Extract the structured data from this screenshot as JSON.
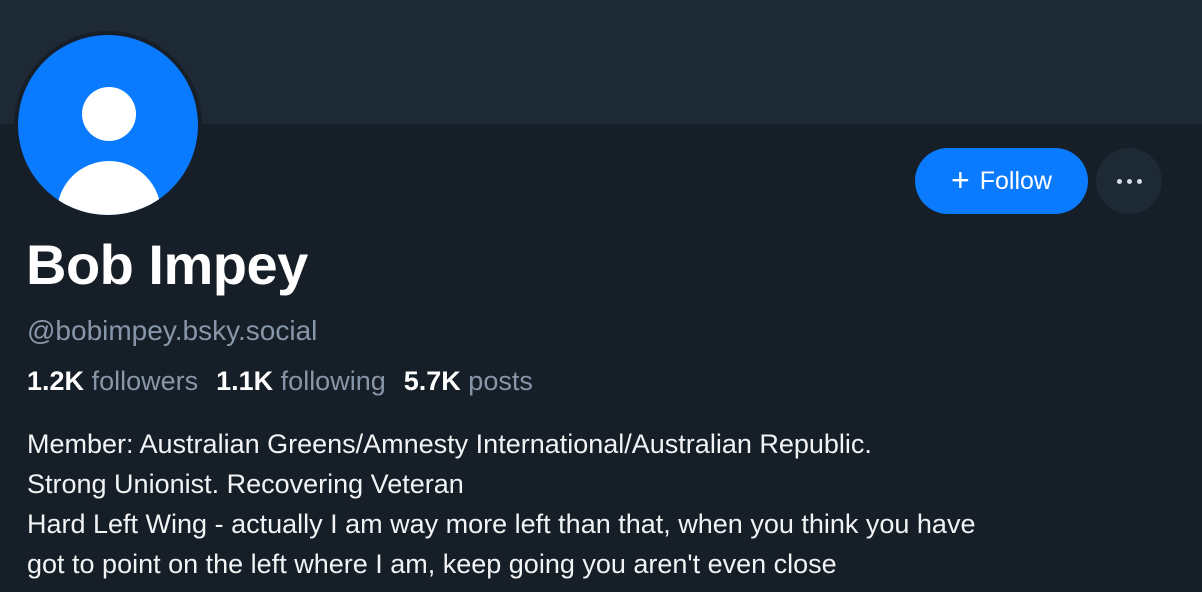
{
  "profile": {
    "display_name": "Bob Impey",
    "handle": "@bobimpey.bsky.social",
    "avatar_icon": "default-user-avatar-icon",
    "stats": {
      "followers_count": "1.2K",
      "followers_label": "followers",
      "following_count": "1.1K",
      "following_label": "following",
      "posts_count": "5.7K",
      "posts_label": "posts"
    },
    "bio_lines": [
      "Member: Australian Greens/Amnesty International/Australian Republic.",
      "Strong Unionist. Recovering Veteran",
      "Hard Left Wing - actually I am way more left than that, when you think you have",
      "got to point on the left where I am, keep going you aren't even close"
    ]
  },
  "actions": {
    "follow_icon": "plus-icon",
    "follow_label": "Follow",
    "more_icon": "ellipsis-icon"
  },
  "colors": {
    "background": "#161e27",
    "banner": "#1e2936",
    "accent": "#0a7aff",
    "muted_text": "#8796a8",
    "text": "#f1f3f5"
  }
}
